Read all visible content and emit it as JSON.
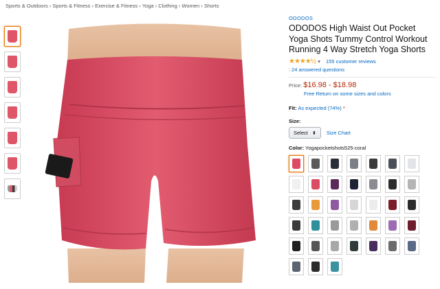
{
  "breadcrumbs": [
    "Sports & Outdoors",
    "Sports & Fitness",
    "Exercise & Fitness",
    "Yoga",
    "Clothing",
    "Women",
    "Shorts"
  ],
  "breadcrumb_sep": "›",
  "product": {
    "brand": "ODODOS",
    "title": "ODODOS High Waist Out Pocket Yoga Shots Tummy Control Workout Running 4 Way Stretch Yoga Shorts",
    "stars": "★★★★½",
    "rating_dropdown": "▾",
    "reviews": "155 customer reviews",
    "answered": "24 answered questions",
    "price_label": "Price:",
    "price": "$16.98 - $18.98",
    "free_return": "Free Return on some sizes and colors",
    "fit_label": "Fit:",
    "fit_value": "As expected (74%)",
    "size_label": "Size:",
    "size_select": "Select",
    "size_chart": "Size Chart",
    "color_label": "Color:",
    "color_value": "Yogapocketshots525-coral"
  },
  "thumbnails": [
    "#df5668",
    "#df5668",
    "#df5668",
    "#df5668",
    "#df5668",
    "#df5668",
    "multi"
  ],
  "swatch_colors": [
    "#dc4b63",
    "#5a5a5a",
    "#2a2d3a",
    "#7b7f86",
    "#3a3a3a",
    "#4a4f58",
    "#e2e4ea",
    "#f0f0f0",
    "#d94c63",
    "#5b2a5a",
    "#1e2433",
    "#8a8c92",
    "#2d2d2d",
    "#b5b5b5",
    "#3b3b3b",
    "#e89a3b",
    "#8f5aa0",
    "#d6d6d6",
    "#ececec",
    "#7a1f2a",
    "#2b2b2b",
    "#3c3c3c",
    "#2f8f9b",
    "#9a9a9a",
    "#b0b0b0",
    "#e08a3a",
    "#9c6bb0",
    "#6d1d2c",
    "#1f1f1f",
    "#555",
    "#a8a8a8",
    "#2e3b3a",
    "#4a2c5e",
    "#6b6b6b",
    "#5a6a86",
    "#5b6470",
    "#2c2c2c",
    "#3b93a0"
  ]
}
